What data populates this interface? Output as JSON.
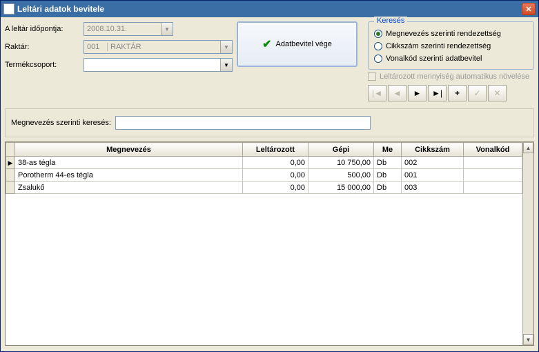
{
  "window": {
    "title": "Leltári adatok bevitele"
  },
  "form": {
    "date_label": "A leltár időpontja:",
    "date_value": "2008.10.31.",
    "warehouse_label": "Raktár:",
    "warehouse_code": "001",
    "warehouse_name": "RAKTÁR",
    "productgroup_label": "Termékcsoport:"
  },
  "big_button": {
    "label": "Adatbevitel vége"
  },
  "search_group": {
    "legend": "Keresés",
    "options": [
      {
        "label": "Megnevezés szerinti rendezettség",
        "selected": true
      },
      {
        "label": "Cikkszám szerinti rendezettség",
        "selected": false
      },
      {
        "label": "Vonalkód szerinti adatbevitel",
        "selected": false
      }
    ]
  },
  "checkbox": {
    "label": "Leltározott mennyiség automatikus növelése"
  },
  "nav": {
    "first": "|◄",
    "prev": "◄",
    "next": "►",
    "last": "►|",
    "plus": "+",
    "check": "✓",
    "x": "✕"
  },
  "searchbar": {
    "label": "Megnevezés szerinti keresés:"
  },
  "grid": {
    "headers": {
      "name": "Megnevezés",
      "counted": "Leltározott",
      "computed": "Gépi",
      "unit": "Me",
      "itemno": "Cikkszám",
      "barcode": "Vonalkód"
    },
    "rows": [
      {
        "name": "38-as tégla",
        "counted": "0,00",
        "computed": "10 750,00",
        "unit": "Db",
        "itemno": "002",
        "barcode": "",
        "current": true
      },
      {
        "name": "Porotherm 44-es tégla",
        "counted": "0,00",
        "computed": "500,00",
        "unit": "Db",
        "itemno": "001",
        "barcode": "",
        "current": false
      },
      {
        "name": "Zsalukő",
        "counted": "0,00",
        "computed": "15 000,00",
        "unit": "Db",
        "itemno": "003",
        "barcode": "",
        "current": false
      }
    ]
  }
}
